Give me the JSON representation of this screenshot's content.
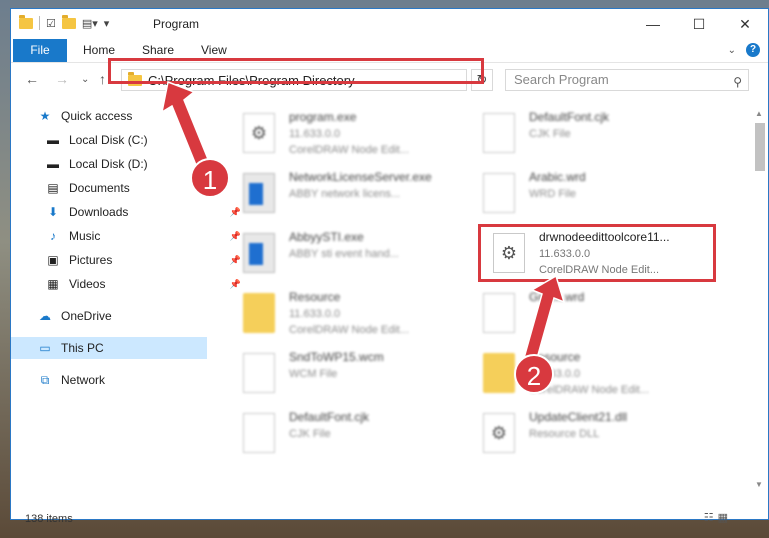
{
  "window": {
    "title": "Program"
  },
  "ribbon": {
    "file": "File",
    "home": "Home",
    "share": "Share",
    "view": "View"
  },
  "address": {
    "path": "C:\\Program Files\\Program Directory",
    "search_placeholder": "Search Program"
  },
  "nav_items": [
    {
      "label": "Quick access",
      "icon": "star-icon"
    },
    {
      "label": "Local Disk (C:)",
      "icon": "drive-icon"
    },
    {
      "label": "Local Disk (D:)",
      "icon": "drive-icon"
    },
    {
      "label": "Documents",
      "icon": "documents-icon"
    },
    {
      "label": "Downloads",
      "icon": "download-icon"
    },
    {
      "label": "Music",
      "icon": "music-icon"
    },
    {
      "label": "Pictures",
      "icon": "pictures-icon"
    },
    {
      "label": "Videos",
      "icon": "video-icon"
    },
    {
      "label": "OneDrive",
      "icon": "cloud-icon"
    },
    {
      "label": "This PC",
      "icon": "computer-icon"
    },
    {
      "label": "Network",
      "icon": "network-icon"
    }
  ],
  "files": [
    {
      "name": "program.exe",
      "line2": "11.633.0.0",
      "line3": "CorelDRAW Node Edit...",
      "icon": "exe-icon"
    },
    {
      "name": "DefaultFont.cjk",
      "line2": "CJK File",
      "line3": "",
      "icon": "document-icon"
    },
    {
      "name": "NetworkLicenseServer.exe",
      "line2": "ABBY network licens...",
      "line3": "",
      "icon": "app-icon"
    },
    {
      "name": "Arabic.wrd",
      "line2": "WRD File",
      "line3": "",
      "icon": "document-icon"
    },
    {
      "name": "AbbyySTI.exe",
      "line2": "ABBY sti event hand...",
      "line3": "",
      "icon": "app-icon"
    },
    {
      "name": "drwnodeedittoolcore11...",
      "line2": "11.633.0.0",
      "line3": "CorelDRAW Node Edit...",
      "icon": "dll-gear-icon"
    },
    {
      "name": "Resource",
      "line2": "11.633.0.0",
      "line3": "CorelDRAW Node Edit...",
      "icon": "folder-icon"
    },
    {
      "name": "Greek.wrd",
      "line2": "",
      "line3": "",
      "icon": "document-icon"
    },
    {
      "name": "SndToWP15.wcm",
      "line2": "WCM File",
      "line3": "",
      "icon": "document-icon"
    },
    {
      "name": "Resource",
      "line2": "11.633.0.0",
      "line3": "CorelDRAW Node Edit...",
      "icon": "folder-icon"
    },
    {
      "name": "DefaultFont.cjk",
      "line2": "CJK File",
      "line3": "",
      "icon": "document-icon"
    },
    {
      "name": "UpdateClient21.dll",
      "line2": "Resource DLL",
      "line3": "",
      "icon": "dll-gear-icon"
    }
  ],
  "status": {
    "count": "138 items"
  },
  "annotations": {
    "step1": "1",
    "step2": "2"
  },
  "colors": {
    "highlight": "#d8393f",
    "accent": "#1979ca"
  }
}
